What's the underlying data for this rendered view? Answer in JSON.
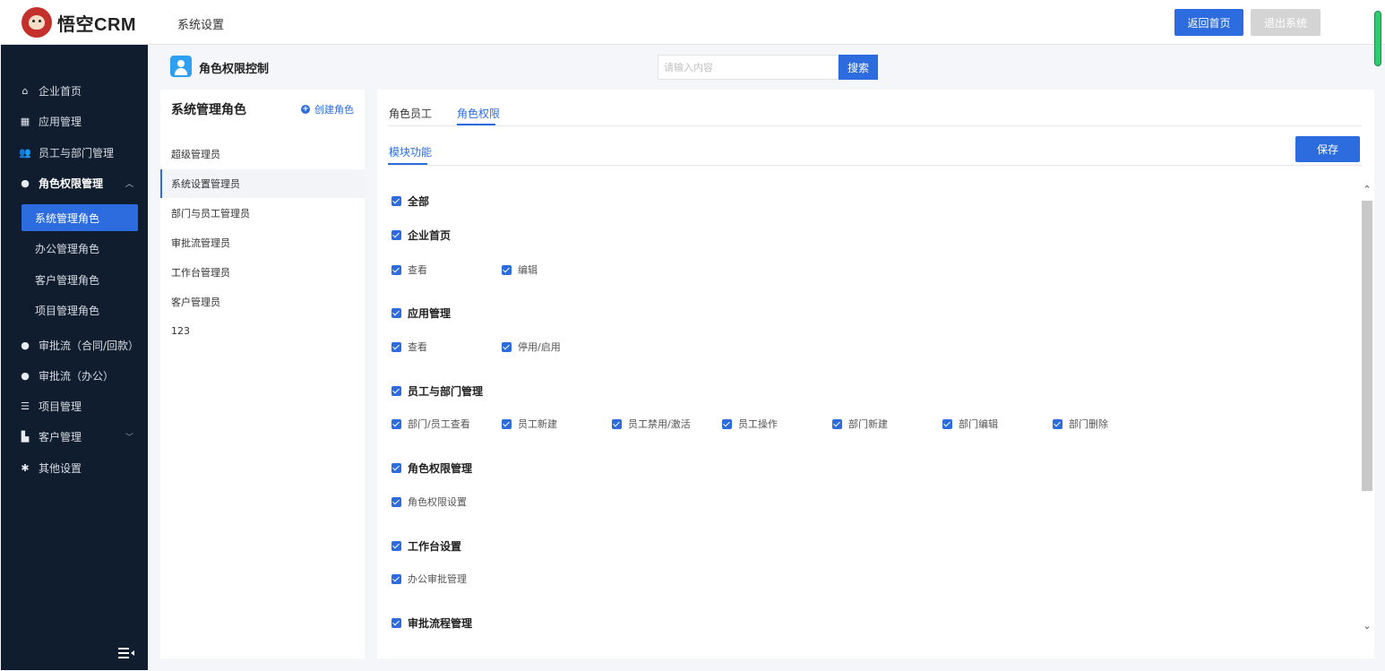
{
  "header": {
    "logo_text": "悟空CRM",
    "section_title": "系统设置",
    "home_button": "返回首页",
    "logout_button": "退出系统"
  },
  "sidebar": {
    "items": [
      {
        "label": "企业首页",
        "icon": "home-icon"
      },
      {
        "label": "应用管理",
        "icon": "grid-icon"
      },
      {
        "label": "员工与部门管理",
        "icon": "users-icon"
      },
      {
        "label": "角色权限管理",
        "icon": "user-icon",
        "expanded": true
      },
      {
        "label": "审批流（合同/回款）",
        "icon": "user-icon"
      },
      {
        "label": "审批流（办公）",
        "icon": "user-icon"
      },
      {
        "label": "项目管理",
        "icon": "list-icon"
      },
      {
        "label": "客户管理",
        "icon": "building-icon"
      },
      {
        "label": "其他设置",
        "icon": "gear-icon"
      }
    ],
    "subitems": [
      {
        "label": "系统管理角色",
        "active": true
      },
      {
        "label": "办公管理角色"
      },
      {
        "label": "客户管理角色"
      },
      {
        "label": "项目管理角色"
      }
    ]
  },
  "page": {
    "title": "角色权限控制",
    "search_placeholder": "请输入内容",
    "search_button": "搜索"
  },
  "roles": {
    "title": "系统管理角色",
    "create_label": "创建角色",
    "items": [
      "超级管理员",
      "系统设置管理员",
      "部门与员工管理员",
      "审批流管理员",
      "工作台管理员",
      "客户管理员",
      "123"
    ],
    "active_index": 1
  },
  "main": {
    "tabs": [
      "角色员工",
      "角色权限"
    ],
    "active_tab": 1,
    "subtab": "模块功能",
    "save_button": "保存",
    "permissions": {
      "all": "全部",
      "groups": [
        {
          "label": "企业首页",
          "items": [
            "查看",
            "编辑"
          ]
        },
        {
          "label": "应用管理",
          "items": [
            "查看",
            "停用/启用"
          ]
        },
        {
          "label": "员工与部门管理",
          "items": [
            "部门/员工查看",
            "员工新建",
            "员工禁用/激活",
            "员工操作",
            "部门新建",
            "部门编辑",
            "部门删除"
          ]
        },
        {
          "label": "角色权限管理",
          "items": [
            "角色权限设置"
          ]
        },
        {
          "label": "工作台设置",
          "items": [
            "办公审批管理"
          ]
        },
        {
          "label": "审批流程管理",
          "items": []
        }
      ]
    }
  },
  "colors": {
    "primary": "#2d6cdf",
    "sidebar_bg": "#0f1d2e",
    "disabled": "#d4d4d4"
  }
}
